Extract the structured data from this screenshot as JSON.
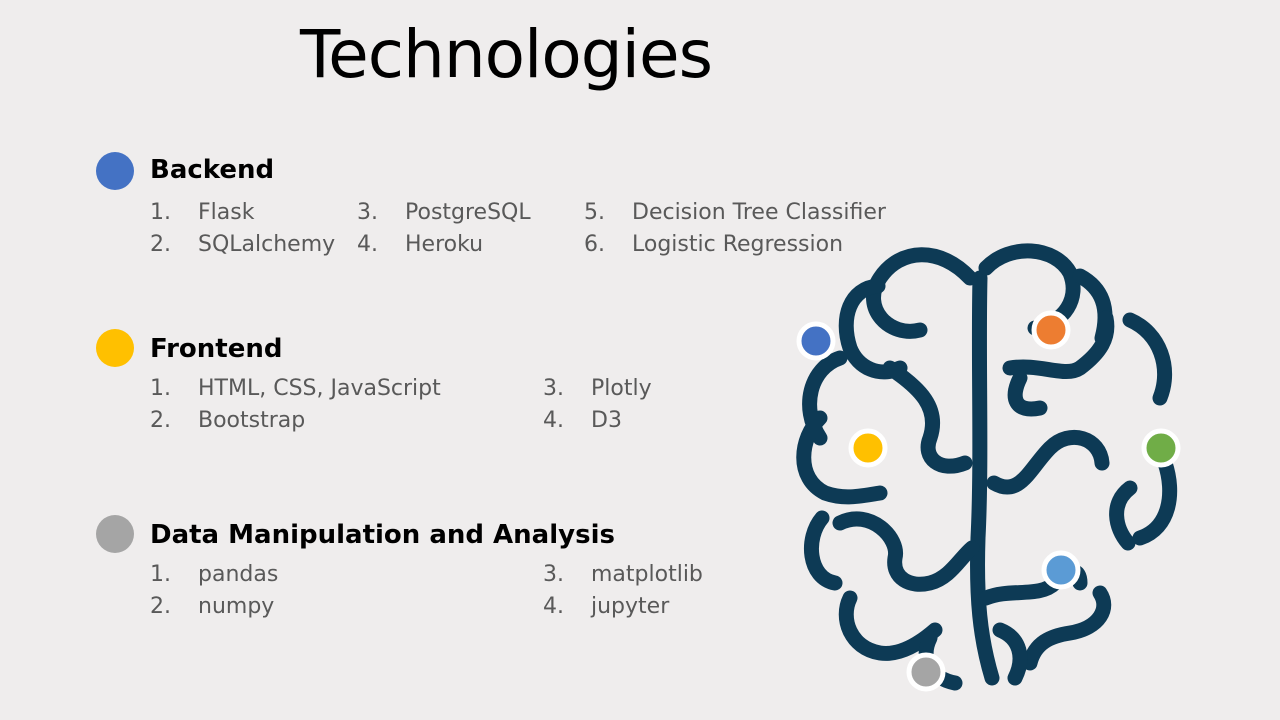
{
  "slide": {
    "title": "Technologies"
  },
  "backend": {
    "heading": "Backend",
    "color": "#4472c4",
    "items": [
      {
        "num": "1.",
        "label": "Flask"
      },
      {
        "num": "2.",
        "label": "SQLalchemy"
      },
      {
        "num": "3.",
        "label": "PostgreSQL"
      },
      {
        "num": "4.",
        "label": "Heroku"
      },
      {
        "num": "5.",
        "label": "Decision Tree Classifier"
      },
      {
        "num": "6.",
        "label": "Logistic Regression"
      }
    ]
  },
  "frontend": {
    "heading": "Frontend",
    "color": "#ffc000",
    "items": [
      {
        "num": "1.",
        "label": "HTML, CSS, JavaScript"
      },
      {
        "num": "2.",
        "label": "Bootstrap"
      },
      {
        "num": "3.",
        "label": "Plotly"
      },
      {
        "num": "4.",
        "label": "D3"
      }
    ]
  },
  "data": {
    "heading": "Data Manipulation and Analysis",
    "color": "#a5a5a5",
    "items": [
      {
        "num": "1.",
        "label": "pandas"
      },
      {
        "num": "2.",
        "label": "numpy"
      },
      {
        "num": "3.",
        "label": "matplotlib"
      },
      {
        "num": "4.",
        "label": "jupyter"
      }
    ]
  },
  "graphic": {
    "icon": "brain-icon",
    "stroke_color": "#0d3a55",
    "node_colors": [
      "#4472c4",
      "#ed7d31",
      "#ffc000",
      "#70ad47",
      "#5b9bd5",
      "#a5a5a5"
    ]
  }
}
